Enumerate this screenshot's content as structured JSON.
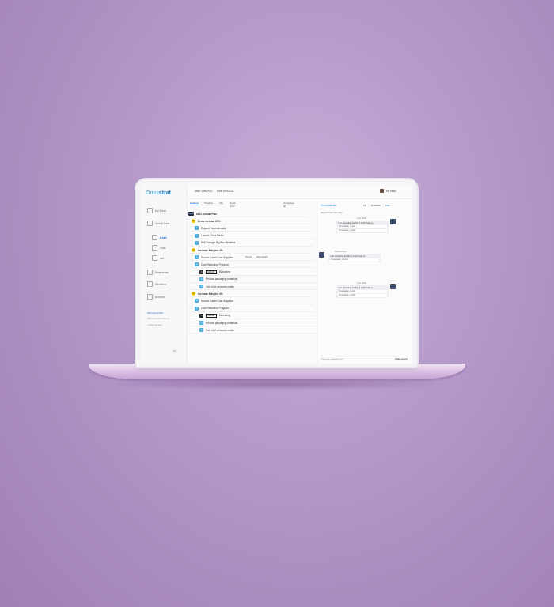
{
  "app": {
    "logo_prefix": "Omni",
    "logo_suffix": "strat"
  },
  "sidebar": {
    "items": [
      {
        "label": "My Desk"
      },
      {
        "label": "Social feed"
      },
      {
        "label": "Lead"
      },
      {
        "label": "Plan"
      },
      {
        "label": "Act"
      },
      {
        "label": "Snapshots"
      },
      {
        "label": "Sandbox"
      },
      {
        "label": "Archive"
      }
    ],
    "plans": [
      "2021 Annual Plan",
      "2021 Alternative Plan ch..."
    ],
    "create": "Create new plan",
    "bottom": "Main"
  },
  "topbar": {
    "start": "Start: Dec2021",
    "end": "End: Dec2021",
    "user": "Hi, Matt"
  },
  "tabs": [
    {
      "label": "Actions"
    },
    {
      "label": "Timeline"
    },
    {
      "label": "Tag"
    },
    {
      "label": "Quick entry"
    }
  ],
  "expand": "Compress all",
  "plan": {
    "rows": [
      {
        "badge": "PLAN",
        "style": "b-dark",
        "text": "2021 Annual Plan",
        "indent": 0
      },
      {
        "badge": "G",
        "style": "b-yel",
        "text": "Grow revenue 20%",
        "indent": 4
      },
      {
        "badge": "1",
        "style": "b-blue",
        "text": "Expand Internationally",
        "indent": 8
      },
      {
        "badge": "1",
        "style": "b-blue",
        "text": "Launch Clock Radio",
        "indent": 8
      },
      {
        "badge": "1",
        "style": "b-blue",
        "text": "Sell Through Big Box Retailers",
        "indent": 8
      },
      {
        "badge": "G",
        "style": "b-yel",
        "text": "Increase Margins 4%",
        "indent": 4
      },
      {
        "badge": "1",
        "style": "b-blue",
        "text": "Source Lower Cost Suppliers",
        "indent": 8
      },
      {
        "badge": "1",
        "style": "b-blue",
        "text": "Cost Reduction Program",
        "indent": 8
      },
      {
        "badge": "S",
        "style": "b-black",
        "text": "Marketing",
        "indent": 14,
        "chip": "GROUP"
      },
      {
        "badge": "A",
        "style": "b-blue",
        "text": "Reduce packaging materials",
        "indent": 14
      },
      {
        "badge": "A",
        "style": "b-blue",
        "text": "Get rid of welcome mailer",
        "indent": 14
      },
      {
        "badge": "G",
        "style": "b-yel",
        "text": "Increase Margins 4%",
        "indent": 4
      },
      {
        "badge": "1",
        "style": "b-blue",
        "text": "Source Lower Cost Suppliers",
        "indent": 8
      },
      {
        "badge": "1",
        "style": "b-blue",
        "text": "Cost Reduction Program",
        "indent": 8
      },
      {
        "badge": "S",
        "style": "b-black",
        "text": "Marketing",
        "indent": 14,
        "chip": "GROUP"
      },
      {
        "badge": "A",
        "style": "b-blue",
        "text": "Reduce packaging materials",
        "indent": 14
      },
      {
        "badge": "A",
        "style": "b-blue",
        "text": "Get rid of welcome mailer",
        "indent": 14
      }
    ],
    "hover_actions": [
      "Drop-In",
      "Show details"
    ]
  },
  "chat": {
    "title_prefix": "Social",
    "title_suffix": "strat",
    "tabs": [
      "All",
      "Requests",
      "Files"
    ],
    "context": "Expand Internationally",
    "messages": [
      {
        "author": "John Smith",
        "text": "I am uploading the file, it might help us",
        "files": [
          "Presentation_v1.pdf",
          "Presentation_v2.pdf"
        ]
      },
      {
        "author": "Monika Howe",
        "text": "I am uploading the file, it might help us",
        "files": [
          "Presentation_v4.docx"
        ]
      },
      {
        "author": "John Smith",
        "text": "I am uploading the file, it might help us",
        "files": [
          "Presentation_v1.pdf",
          "Presentation_v2.pdf"
        ]
      }
    ],
    "input_placeholder": "Type your message here...",
    "send": "Make request"
  }
}
